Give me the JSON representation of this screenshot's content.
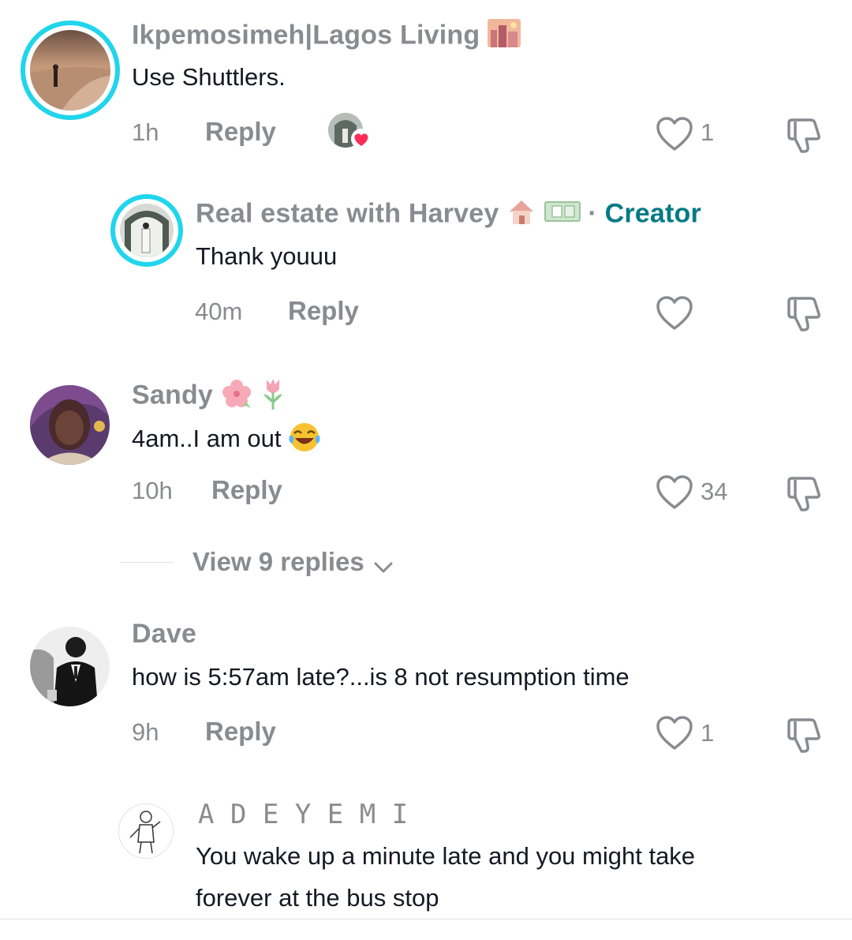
{
  "comments": [
    {
      "username": "Ikpemosimeh|Lagos Living",
      "text": "Use Shuttlers.",
      "time": "1h",
      "reply_label": "Reply",
      "likes": "1",
      "avatar_icon": "beach-silhouette-avatar",
      "liked_by_creator": true
    },
    {
      "username": "Real estate with Harvey",
      "creator_separator": "·",
      "creator_label": "Creator",
      "text": "Thank youuu",
      "time": "40m",
      "reply_label": "Reply",
      "likes": "",
      "avatar_icon": "interior-avatar"
    },
    {
      "username": "Sandy",
      "text": "4am..I am out",
      "time": "10h",
      "reply_label": "Reply",
      "likes": "34",
      "avatar_icon": "portrait-avatar",
      "view_replies": "View 9 replies"
    },
    {
      "username": "Dave",
      "text": "how is 5:57am late?...is 8 not resumption time",
      "time": "9h",
      "reply_label": "Reply",
      "likes": "1",
      "avatar_icon": "suit-man-avatar"
    },
    {
      "username": "A D E Y E M I",
      "text_line1": "You wake up a minute late and you might take",
      "text_line2": "forever at the bus stop",
      "avatar_icon": "sketch-avatar"
    }
  ],
  "colors": {
    "ring": "#20d5ec",
    "creator": "#047a84",
    "muted": "#8a8b91",
    "heart_badge": "#fe2c55"
  }
}
